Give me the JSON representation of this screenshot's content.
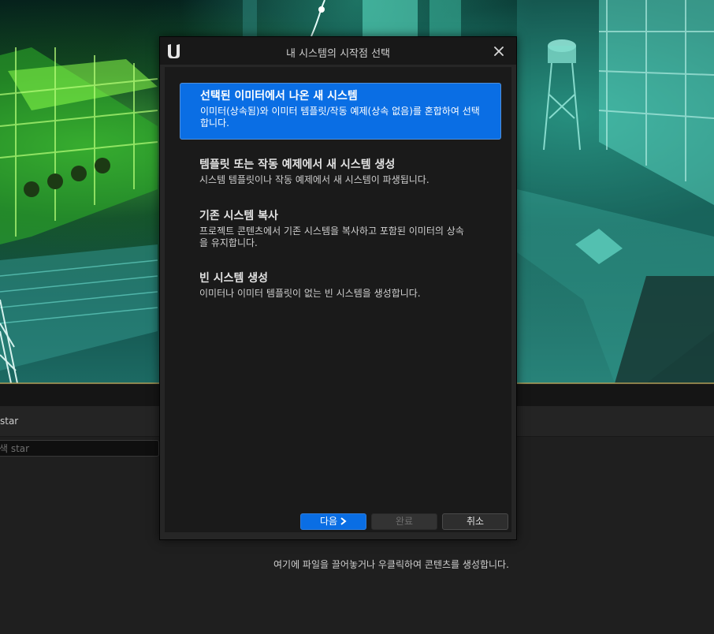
{
  "dialog": {
    "title": "내 시스템의 시작점 선택",
    "options": [
      {
        "title": "선택된 이미터에서 나온 새 시스템",
        "description": "이미터(상속됨)와 이미터 템플릿/작동 예제(상속 없음)를 혼합하여 선택합니다.",
        "selected": true
      },
      {
        "title": "템플릿 또는 작동 예제에서 새 시스템 생성",
        "description": "시스템 템플릿이나 작동 예제에서 새 시스템이 파생됩니다.",
        "selected": false
      },
      {
        "title": "기존 시스템 복사",
        "description": "프로젝트 콘텐츠에서 기존 시스템을 복사하고 포함된 이미터의 상속을 유지합니다.",
        "selected": false
      },
      {
        "title": "빈 시스템 생성",
        "description": "이미터나 이미터 템플릿이 없는 빈 시스템을 생성합니다.",
        "selected": false
      }
    ],
    "buttons": {
      "next": "다음",
      "finish": "완료",
      "cancel": "취소"
    },
    "icons": {
      "logo": "unreal-logo-icon",
      "close": "close-icon",
      "next_arrow": "chevron-right-icon"
    }
  },
  "background": {
    "panel_title": "star",
    "search_placeholder": "색 star",
    "drop_hint": "여기에 파일을 끌어놓거나 우클릭하여 콘텐츠를 생성합니다."
  },
  "colors": {
    "accent": "#0a6ee4",
    "dialog_bg": "#1a1a1a",
    "titlebar_bg": "#181818",
    "window_bg": "#1f1f1f"
  }
}
